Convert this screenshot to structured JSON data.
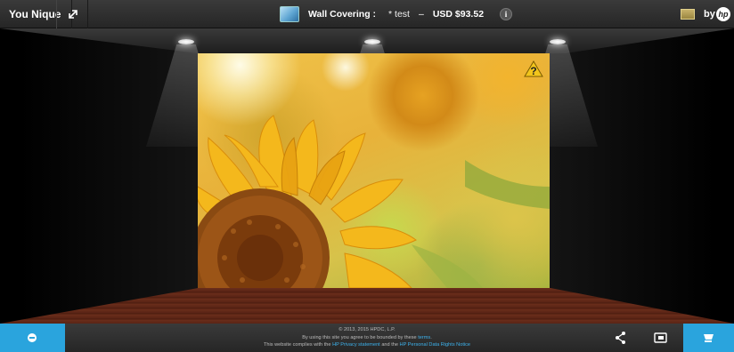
{
  "header": {
    "brand": "You Nique",
    "wall_label": "Wall Covering :",
    "wall_value": "* test",
    "separator": "–",
    "price": "USD $93.52",
    "info": "i",
    "by": "by"
  },
  "viewer": {
    "help_symbol": "?"
  },
  "footer": {
    "copyright": "© 2013, 2015 HPDC, L.P.",
    "terms_text": "By using this site you agree to be bounded by these",
    "terms_link": "terms",
    "terms_end": ".",
    "comply_text": "This website complies with the",
    "privacy_link": "HP Privacy statement",
    "and_text": "and the",
    "personal_link": "HP Personal Data Rights Notice"
  },
  "colors": {
    "accent": "#2aa4dd",
    "floor": "#5a2415"
  },
  "icons": [
    "expand-icon",
    "wall-thumbnail-icon",
    "info-icon",
    "flag-icon",
    "hp-logo-icon",
    "help-warning-icon",
    "minus-circle-icon",
    "share-icon",
    "card-icon",
    "cart-icon"
  ]
}
